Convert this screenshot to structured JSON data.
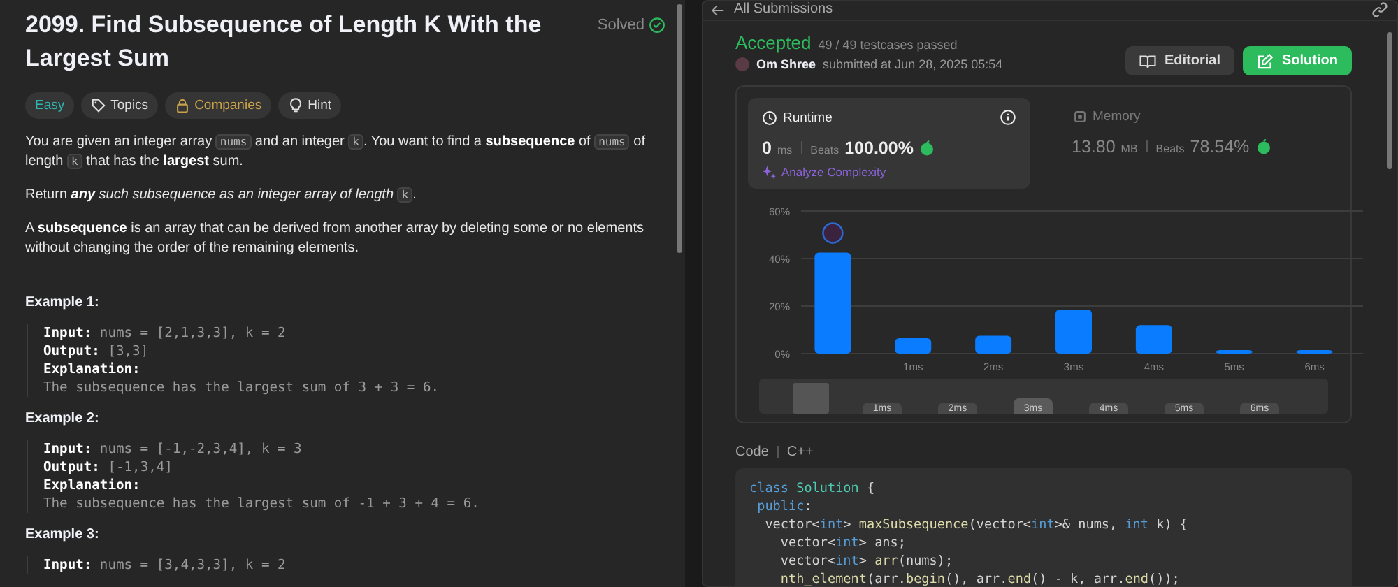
{
  "problem": {
    "title": "2099. Find Subsequence of Length K With the Largest Sum",
    "status": "Solved",
    "tags": [
      {
        "label": "Easy",
        "kind": "difficulty"
      },
      {
        "label": "Topics",
        "kind": "topics"
      },
      {
        "label": "Companies",
        "kind": "companies"
      },
      {
        "label": "Hint",
        "kind": "hint"
      }
    ],
    "paragraphs": [
      [
        {
          "kind": "text",
          "text": "You are given an integer array "
        },
        {
          "kind": "code",
          "text": "nums"
        },
        {
          "kind": "text",
          "text": " and an integer "
        },
        {
          "kind": "code",
          "text": "k"
        },
        {
          "kind": "text",
          "text": ". You want to find a **subsequence** of "
        },
        {
          "kind": "code",
          "text": "nums"
        },
        {
          "kind": "text",
          "text": " of length "
        },
        {
          "kind": "code",
          "text": "k"
        },
        {
          "kind": "text",
          "text": " that has the **largest** sum."
        }
      ],
      [
        {
          "kind": "text",
          "text": "Return "
        },
        {
          "kind": "emph",
          "text": "**any** such subsequence as an integer array of length "
        },
        {
          "kind": "code",
          "text": "k"
        },
        {
          "kind": "text",
          "text": "."
        }
      ],
      [
        {
          "kind": "text",
          "text": "A **subsequence** is an array that can be derived from another array by deleting some or no elements without changing the order of the remaining elements."
        }
      ]
    ],
    "examples": [
      {
        "title": "Example 1:",
        "lines": [
          {
            "label": "Input:",
            "value": "nums = [2,1,3,3], k = 2"
          },
          {
            "label": "Output:",
            "value": "[3,3]"
          },
          {
            "label": "Explanation:"
          },
          {
            "value": "The subsequence has the largest sum of 3 + 3 = 6."
          }
        ]
      },
      {
        "title": "Example 2:",
        "lines": [
          {
            "label": "Input:",
            "value": "nums = [-1,-2,3,4], k = 3"
          },
          {
            "label": "Output:",
            "value": "[-1,3,4]"
          },
          {
            "label": "Explanation:"
          },
          {
            "value": "The subsequence has the largest sum of -1 + 3 + 4 = 6."
          }
        ]
      },
      {
        "title": "Example 3:",
        "lines": [
          {
            "label": "Input:",
            "value": "nums = [3,4,3,3], k = 2"
          }
        ]
      }
    ]
  },
  "submission": {
    "back_label": "All Submissions",
    "status": "Accepted",
    "testcases": "49 / 49 testcases passed",
    "user": "Om Shree",
    "submitted": "submitted at Jun 28, 2025 05:54",
    "buttons": [
      {
        "label": "Editorial",
        "kind": "secondary"
      },
      {
        "label": "Solution",
        "kind": "primary"
      }
    ],
    "stats": [
      {
        "kind": "runtime",
        "title": "Runtime",
        "value": "0",
        "unit": "ms",
        "beats_label": "Beats",
        "beats": "100.00%",
        "selected": true,
        "link": "Analyze Complexity"
      },
      {
        "kind": "memory",
        "title": "Memory",
        "value": "13.80",
        "unit": "MB",
        "beats_label": "Beats",
        "beats": "78.54%",
        "selected": false
      }
    ],
    "chart": {
      "chart_data": {
        "type": "bar",
        "categories": [
          null,
          "1ms",
          "2ms",
          "3ms",
          "4ms",
          "5ms",
          "6ms"
        ],
        "values": [
          42.5,
          6.5,
          7.5,
          18.5,
          12,
          1.5,
          1.5
        ],
        "ylim": [
          0,
          60
        ],
        "yticks": [
          {
            "value": 0,
            "label": "0%"
          },
          {
            "value": 20,
            "label": "20%"
          },
          {
            "value": 40,
            "label": "40%"
          },
          {
            "value": 60,
            "label": "60%"
          }
        ]
      }
    },
    "navigator": {
      "labels": [
        {
          "label": "1ms",
          "selected": false
        },
        {
          "label": "2ms",
          "selected": false
        },
        {
          "label": "3ms",
          "selected": true
        },
        {
          "label": "4ms",
          "selected": false
        },
        {
          "label": "5ms",
          "selected": false
        },
        {
          "label": "6ms",
          "selected": false
        }
      ]
    },
    "code": {
      "label": "Code",
      "language": "C++",
      "lines": [
        [
          {
            "kind": "kw",
            "text": "class "
          },
          {
            "kind": "type",
            "text": "Solution"
          },
          {
            "kind": "p",
            "text": " {"
          }
        ],
        [
          {
            "kind": "kw",
            "text": " public"
          },
          {
            "kind": "p",
            "text": ":"
          }
        ],
        [
          {
            "kind": "p",
            "text": "  vector<"
          },
          {
            "kind": "kw",
            "text": "int"
          },
          {
            "kind": "p",
            "text": "> "
          },
          {
            "kind": "fn",
            "text": "maxSubsequence"
          },
          {
            "kind": "p",
            "text": "(vector<"
          },
          {
            "kind": "kw",
            "text": "int"
          },
          {
            "kind": "p",
            "text": ">& nums, "
          },
          {
            "kind": "kw",
            "text": "int"
          },
          {
            "kind": "p",
            "text": " k) {"
          }
        ],
        [
          {
            "kind": "p",
            "text": "    vector<"
          },
          {
            "kind": "kw",
            "text": "int"
          },
          {
            "kind": "p",
            "text": "> ans;"
          }
        ],
        [
          {
            "kind": "p",
            "text": "    vector<"
          },
          {
            "kind": "kw",
            "text": "int"
          },
          {
            "kind": "p",
            "text": "> "
          },
          {
            "kind": "fn",
            "text": "arr"
          },
          {
            "kind": "p",
            "text": "(nums);"
          }
        ],
        [
          {
            "kind": "fn",
            "text": "    nth_element"
          },
          {
            "kind": "p",
            "text": "(arr."
          },
          {
            "kind": "fn",
            "text": "begin"
          },
          {
            "kind": "p",
            "text": "(), arr."
          },
          {
            "kind": "fn",
            "text": "end"
          },
          {
            "kind": "p",
            "text": "() - k, arr."
          },
          {
            "kind": "fn",
            "text": "end"
          },
          {
            "kind": "p",
            "text": "());"
          }
        ]
      ]
    }
  }
}
